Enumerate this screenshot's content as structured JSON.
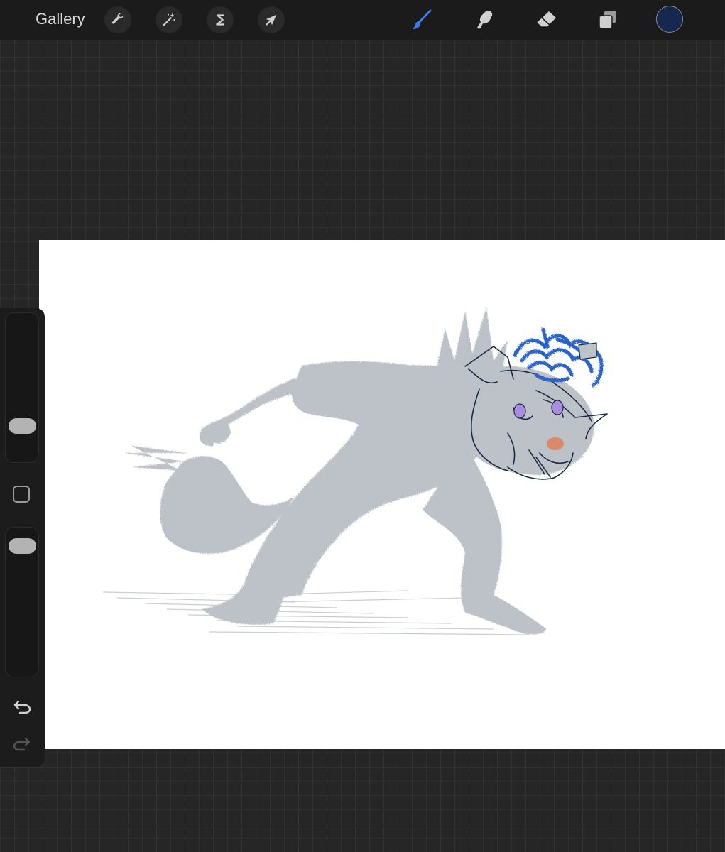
{
  "toolbar": {
    "gallery_label": "Gallery",
    "left_tools": [
      {
        "icon": "wrench-icon",
        "name": "actions"
      },
      {
        "icon": "magic-wand-icon",
        "name": "adjustments"
      },
      {
        "icon": "selection-s-icon",
        "name": "selection"
      },
      {
        "icon": "arrow-cursor-icon",
        "name": "transform"
      }
    ],
    "right_tools": [
      {
        "icon": "brush-icon",
        "name": "paint",
        "active": true
      },
      {
        "icon": "smudge-icon",
        "name": "smudge",
        "active": false
      },
      {
        "icon": "eraser-icon",
        "name": "eraser",
        "active": false
      },
      {
        "icon": "layers-icon",
        "name": "layers",
        "active": false
      }
    ],
    "current_color": "#16284f"
  },
  "colors": {
    "active_tool": "#3b7df0",
    "inactive_tool": "#d0d0d0",
    "sketch_gray": "#bdc1c8",
    "hair_blue": "#2a63c9",
    "line_navy": "#1b2a44",
    "eye_purple": "#a98ee0",
    "nose_orange": "#d88a6a"
  },
  "sidebar": {
    "brush_size": 0.2,
    "opacity": 0.95,
    "icons": [
      "modify-square-icon",
      "undo-icon",
      "redo-icon"
    ]
  }
}
